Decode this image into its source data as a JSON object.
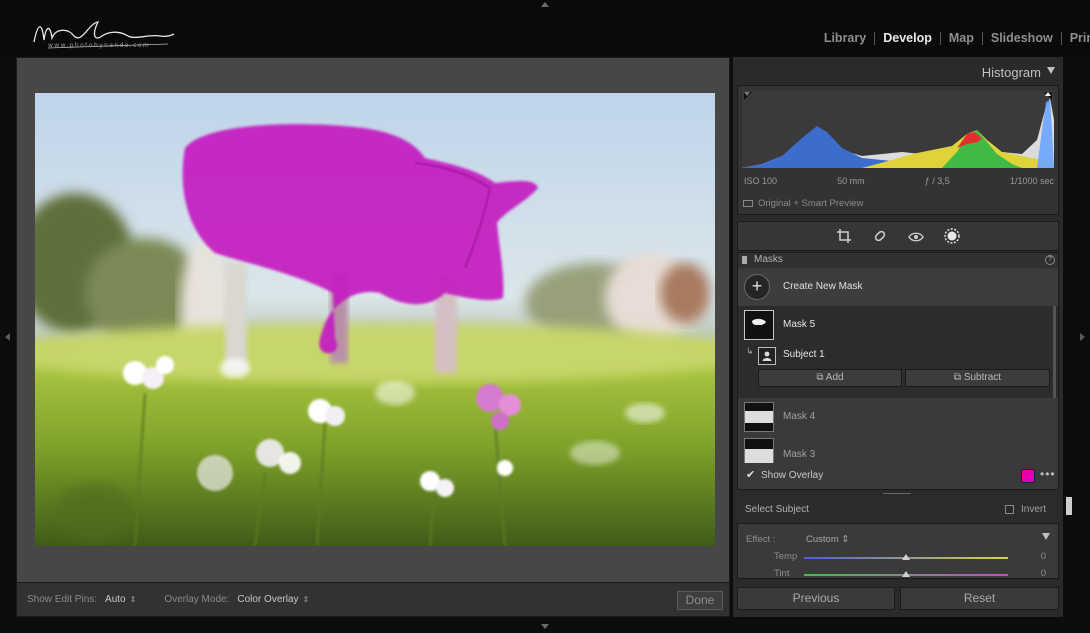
{
  "branding": {
    "logo_sub": "www.photobynando.com"
  },
  "modules": [
    {
      "label": "Library",
      "active": false
    },
    {
      "label": "Develop",
      "active": true
    },
    {
      "label": "Map",
      "active": false
    },
    {
      "label": "Slideshow",
      "active": false
    },
    {
      "label": "Prin",
      "active": false
    }
  ],
  "toolbar": {
    "edit_pins_label": "Show Edit Pins:",
    "edit_pins_value": "Auto",
    "overlay_mode_label": "Overlay Mode:",
    "overlay_mode_value": "Color Overlay",
    "done_label": "Done"
  },
  "histogram": {
    "title": "Histogram",
    "exif": {
      "iso": "ISO 100",
      "focal": "50 mm",
      "aperture": "ƒ / 3,5",
      "shutter": "1/1000 sec"
    },
    "preview_status": "Original + Smart Preview"
  },
  "tools": [
    {
      "icon": "crop-icon"
    },
    {
      "icon": "healing-icon"
    },
    {
      "icon": "red-eye-icon"
    },
    {
      "icon": "masking-icon"
    }
  ],
  "masks": {
    "title": "Masks",
    "help": "?",
    "create_new": "Create New Mask",
    "create_symbol": "+",
    "active_mask": {
      "label": "Mask 5",
      "component": "Subject 1",
      "add_label": "Add",
      "subtract_label": "Subtract"
    },
    "other_masks": [
      "Mask 4",
      "Mask 3"
    ],
    "show_overlay_label": "Show Overlay",
    "overlay_checked": "✔",
    "overlay_color": "#e600b4",
    "more": "•••"
  },
  "component": {
    "title": "Select Subject",
    "invert_label": "Invert"
  },
  "effect": {
    "label": "Effect :",
    "value": "Custom",
    "sliders": [
      {
        "label": "Temp",
        "value": "0",
        "fraction": 0.5
      },
      {
        "label": "Tint",
        "value": "0",
        "fraction": 0.5
      }
    ]
  },
  "bottom": {
    "previous": "Previous",
    "reset": "Reset"
  },
  "colors": {
    "mask_overlay": "#c41ec0",
    "accent": "#e600b4"
  }
}
